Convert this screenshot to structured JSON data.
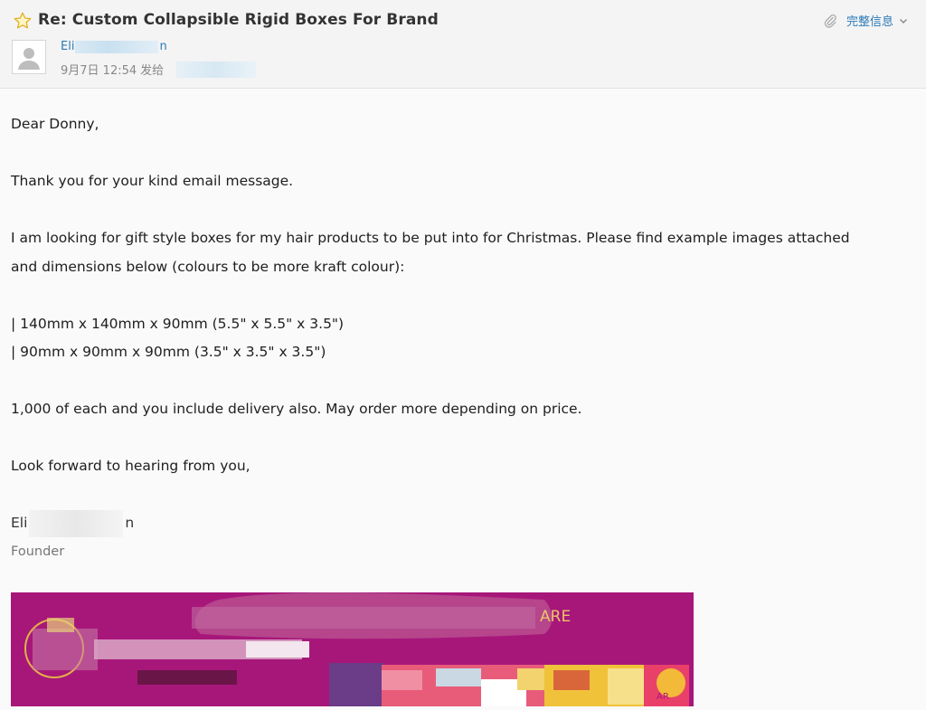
{
  "email": {
    "subject": "Re: Custom Collapsible Rigid Boxes For Brand",
    "full_info_label": "完整信息",
    "sender_prefix": "Eli",
    "sender_suffix": "n",
    "date": "9月7日 12:54",
    "sent_to_label": "发给"
  },
  "body": {
    "greeting": "Dear Donny,",
    "line1": "Thank you for your kind email message.",
    "line2": "I am looking for gift style boxes for my hair products to be put into for Christmas. Please find example images attached",
    "line3": "and dimensions below (colours to be more kraft colour):",
    "dim1": "| 140mm x 140mm x 90mm (5.5\" x 5.5\" x 3.5\")",
    "dim2": "| 90mm x 90mm x 90mm (3.5\" x 3.5\" x 3.5\")",
    "line4": "1,000 of each and you include delivery also. May order more depending on price.",
    "closing": "Look forward to hearing from you,",
    "sig_prefix": "Eli",
    "sig_suffix": "n",
    "sig_title": "Founder"
  },
  "banner": {
    "text_right": "ARE",
    "badge_text": "AR"
  },
  "colors": {
    "accent": "#2a7ab8",
    "banner_bg": "#a7177a",
    "star": "#f5c518"
  },
  "icons": [
    "star-icon",
    "paperclip-icon",
    "chevron-down-icon",
    "avatar-placeholder-icon"
  ]
}
